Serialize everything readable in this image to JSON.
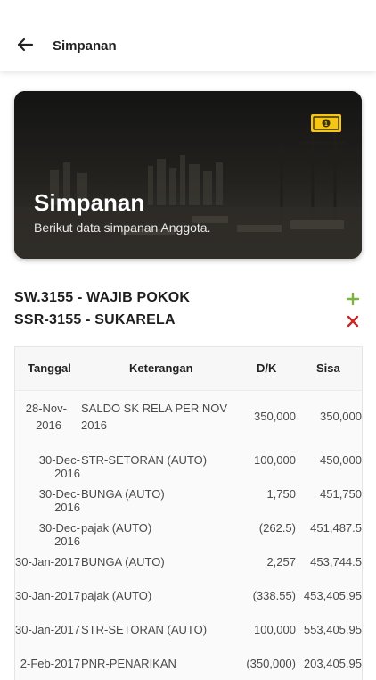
{
  "appbar": {
    "title": "Simpanan",
    "back_icon": "arrow-left-icon"
  },
  "hero": {
    "title": "Simpanan",
    "subtitle": "Berikut data simpanan Anggota.",
    "icon": "money-bill-icon",
    "icon_color": "#f5c518"
  },
  "accounts": [
    {
      "label": "SW.3155 - WAJIB POKOK",
      "action_icon": "plus-icon",
      "action_color": "#7cb342"
    },
    {
      "label": "SSR-3155 - SUKARELA",
      "action_icon": "close-icon",
      "action_color": "#c62828"
    }
  ],
  "table": {
    "headers": {
      "tanggal": "Tanggal",
      "keterangan": "Keterangan",
      "dk": "D/K",
      "sisa": "Sisa"
    },
    "rows": [
      {
        "tanggal_l1": "28-Nov-",
        "tanggal_l2": "2016",
        "ket_l1": "SALDO SK RELA PER NOV",
        "ket_l2": "2016",
        "dk": "350,000",
        "sisa": "350,000"
      },
      {
        "tanggal": "30-Dec-2016",
        "ket": "STR-SETORAN (AUTO)",
        "dk": "100,000",
        "sisa": "450,000"
      },
      {
        "tanggal": "30-Dec-2016",
        "ket": "BUNGA (AUTO)",
        "dk": "1,750",
        "sisa": "451,750"
      },
      {
        "tanggal": "30-Dec-2016",
        "ket": "pajak (AUTO)",
        "dk": "(262.5)",
        "sisa": "451,487.5"
      },
      {
        "tanggal": "30-Jan-2017",
        "ket": "BUNGA (AUTO)",
        "dk": "2,257",
        "sisa": "453,744.5"
      },
      {
        "tanggal": "30-Jan-2017",
        "ket": "pajak (AUTO)",
        "dk": "(338.55)",
        "sisa": "453,405.95"
      },
      {
        "tanggal": "30-Jan-2017",
        "ket": "STR-SETORAN (AUTO)",
        "dk": "100,000",
        "sisa": "553,405.95"
      },
      {
        "tanggal": "2-Feb-2017",
        "ket": "PNR-PENARIKAN",
        "dk": "(350,000)",
        "sisa": "203,405.95"
      }
    ]
  }
}
